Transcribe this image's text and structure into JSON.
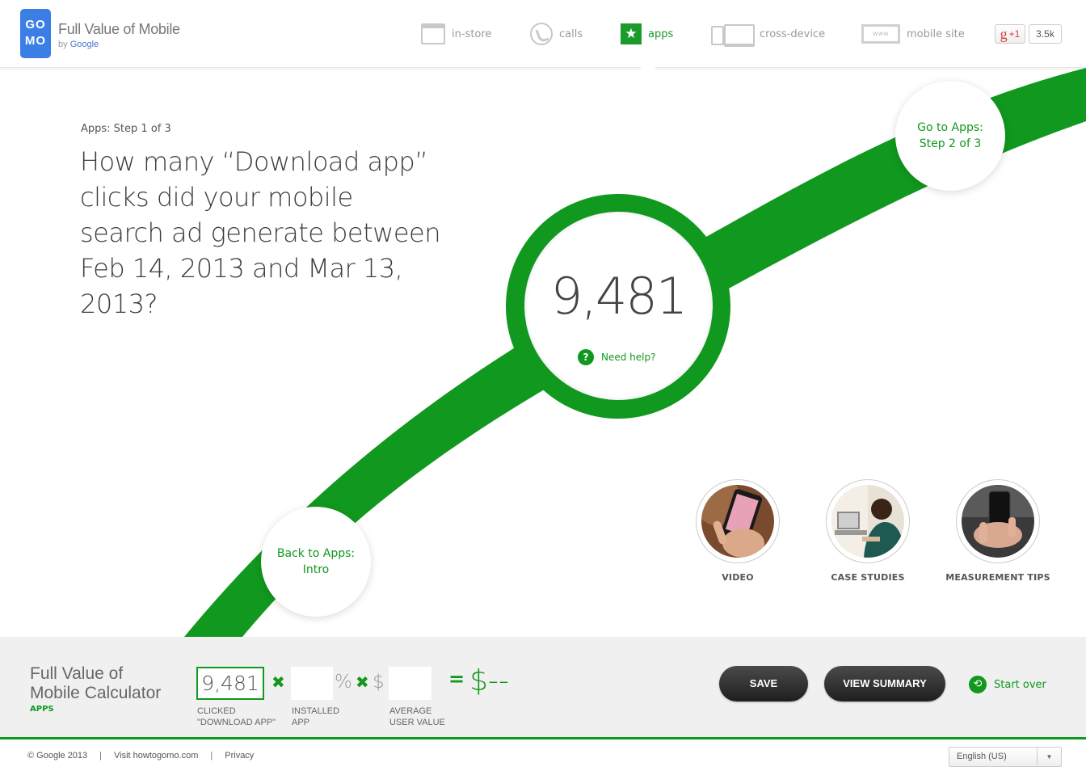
{
  "header": {
    "logo_line1": "GO",
    "logo_line2": "MO",
    "title": "Full Value of Mobile",
    "by_label": "by",
    "by_brand": "Google",
    "nav": [
      {
        "label": "in-store",
        "icon": "store-icon",
        "active": false
      },
      {
        "label": "calls",
        "icon": "phone-icon",
        "active": false
      },
      {
        "label": "apps",
        "icon": "star-icon",
        "active": true
      },
      {
        "label": "cross-device",
        "icon": "devices-icon",
        "active": false
      },
      {
        "label": "mobile site",
        "icon": "www-icon",
        "active": false
      }
    ],
    "www_text": "www",
    "gplus_letter": "g",
    "gplus_label": "+1",
    "gplus_count": "3.5k"
  },
  "main": {
    "step_label": "Apps: Step 1 of 3",
    "question": "How many “Download app” clicks did your mobile search ad generate between Feb 14, 2013 and Mar 13, 2013?",
    "value": "9,481",
    "help_icon": "?",
    "help_label": "Need help?",
    "next_line1": "Go to Apps:",
    "next_line2": "Step 2 of 3",
    "back_line1": "Back to Apps:",
    "back_line2": "Intro",
    "resources": [
      {
        "label": "VIDEO"
      },
      {
        "label": "CASE STUDIES"
      },
      {
        "label": "MEASUREMENT TIPS"
      }
    ]
  },
  "calculator": {
    "title_line1": "Full Value of",
    "title_line2": "Mobile Calculator",
    "subtitle": "APPS",
    "clicks_value": "9,481",
    "clicks_caption_line1": "CLICKED",
    "clicks_caption_line2": "\"DOWNLOAD APP\"",
    "installed_value": "",
    "installed_caption_line1": "INSTALLED",
    "installed_caption_line2": "APP",
    "avg_value": "",
    "avg_caption_line1": "AVERAGE",
    "avg_caption_line2": "USER VALUE",
    "times_symbol": "✖",
    "percent_symbol": "%",
    "dollar_symbol": "$",
    "equals_symbol": "=",
    "result": "$--",
    "save_label": "SAVE",
    "summary_label": "VIEW SUMMARY",
    "start_over_label": "Start over",
    "start_over_icon": "⟲"
  },
  "footer": {
    "copyright": "© Google 2013",
    "separator": "|",
    "visit_link": "Visit howtogomo.com",
    "privacy_link": "Privacy",
    "language": "English (US)",
    "language_arrow": "▼"
  },
  "colors": {
    "accent": "#11981e",
    "logo_blue": "#3b7fe6",
    "button_dark": "#2a2a2a"
  }
}
